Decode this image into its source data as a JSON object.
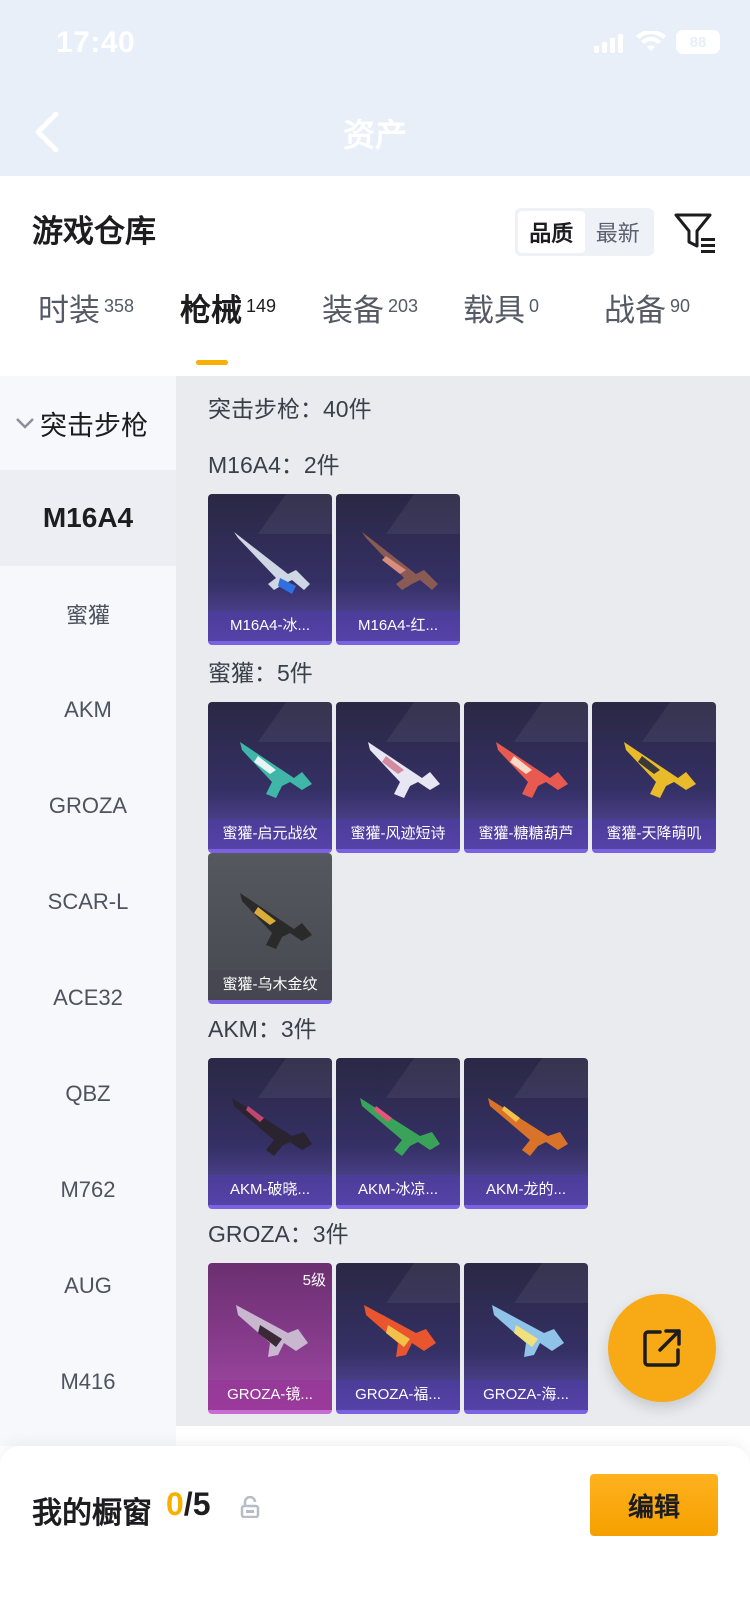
{
  "status_bar": {
    "time": "17:40",
    "battery": "88"
  },
  "header": {
    "title": "资产"
  },
  "panel": {
    "title": "游戏仓库",
    "sort": {
      "quality": "品质",
      "newest": "最新",
      "selected": "品质"
    }
  },
  "tabs": [
    {
      "label": "时装",
      "count": "358"
    },
    {
      "label": "枪械",
      "count": "149",
      "active": true
    },
    {
      "label": "装备",
      "count": "203"
    },
    {
      "label": "载具",
      "count": "0"
    },
    {
      "label": "战备",
      "count": "90"
    }
  ],
  "sidebar": {
    "group": "突击步枪",
    "items": [
      "M16A4",
      "蜜獾",
      "AKM",
      "GROZA",
      "SCAR-L",
      "ACE32",
      "QBZ",
      "M762",
      "AUG",
      "M416"
    ],
    "active": "M16A4"
  },
  "content": {
    "summary": "突击步枪：40件",
    "sections": [
      {
        "title": "M16A4：2件",
        "items": [
          "M16A4-冰...",
          "M16A4-红..."
        ]
      },
      {
        "title": "蜜獾：5件",
        "items": [
          "蜜獾-启元战纹",
          "蜜獾-风迹短诗",
          "蜜獾-糖糖葫芦",
          "蜜獾-天降萌叽",
          "蜜獾-乌木金纹"
        ]
      },
      {
        "title": "AKM：3件",
        "items": [
          "AKM-破晓...",
          "AKM-冰凉...",
          "AKM-龙的..."
        ]
      },
      {
        "title": "GROZA：3件",
        "items": [
          "GROZA-镜...",
          "GROZA-福...",
          "GROZA-海..."
        ],
        "level": "5级"
      }
    ]
  },
  "footer": {
    "label": "我的橱窗",
    "current": "0",
    "total": "/5",
    "edit": "编辑"
  },
  "colors": {
    "accent": "#f5b000",
    "card": "#353065",
    "header": "#e8eff8"
  }
}
